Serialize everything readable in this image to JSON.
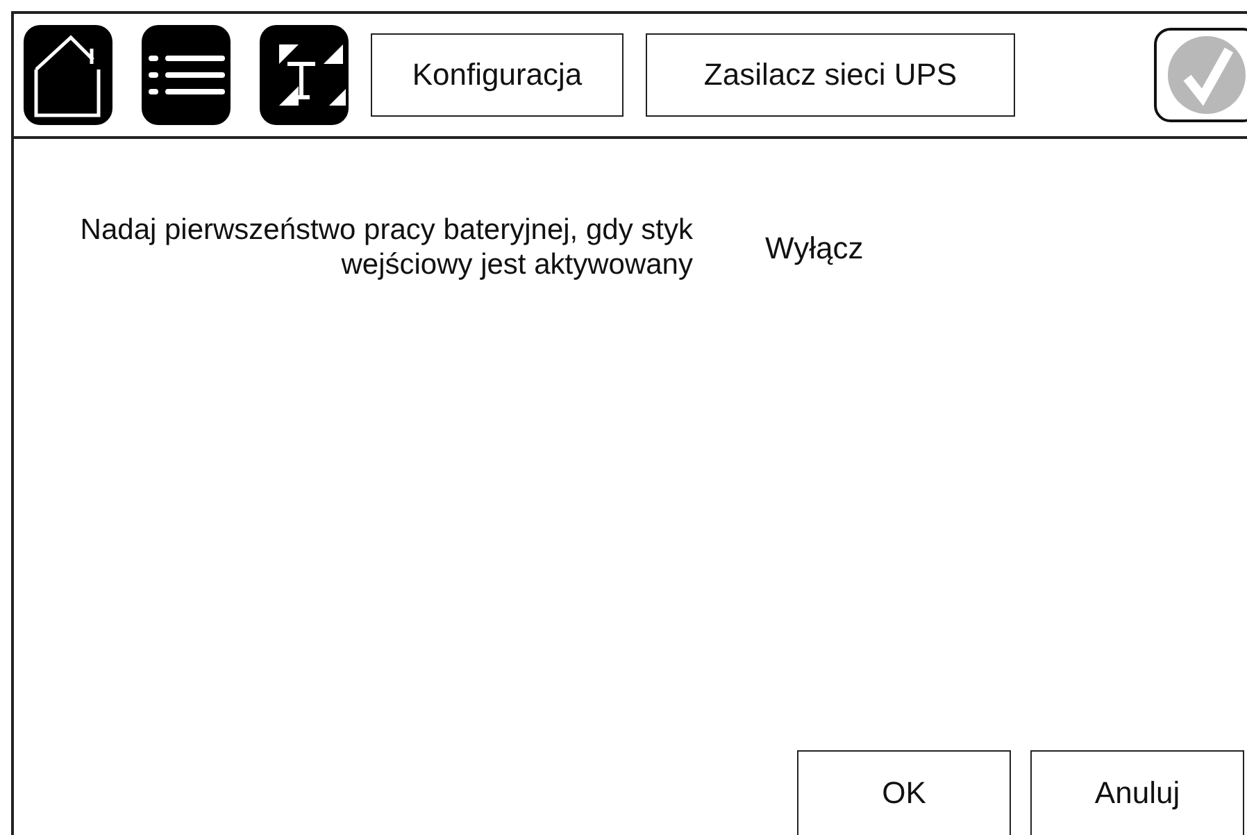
{
  "header": {
    "breadcrumbs": [
      "Konfiguracja",
      "Zasilacz sieci UPS"
    ]
  },
  "setting": {
    "label": "Nadaj pierwszeństwo pracy bateryjnej, gdy styk wejściowy jest aktywowany",
    "value": "Wyłącz"
  },
  "buttons": [
    "OK",
    "Anuluj"
  ]
}
